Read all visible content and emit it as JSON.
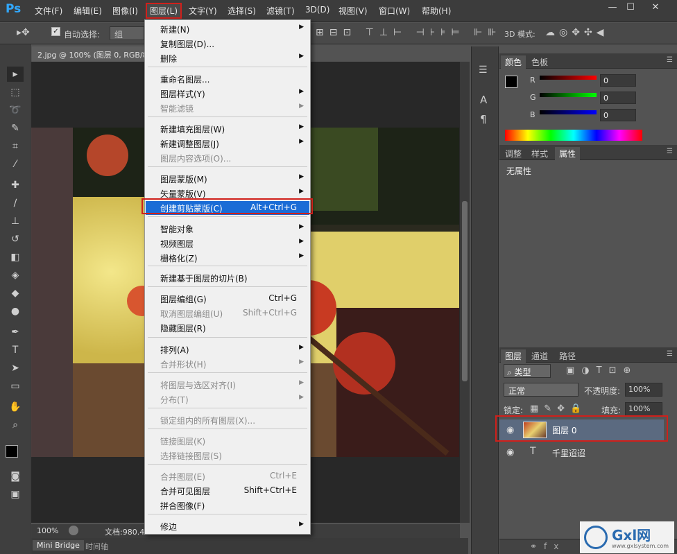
{
  "app": {
    "logo": "Ps"
  },
  "menubar": {
    "items": [
      "文件(F)",
      "编辑(E)",
      "图像(I)",
      "图层(L)",
      "文字(Y)",
      "选择(S)",
      "滤镜(T)",
      "3D(D)",
      "视图(V)",
      "窗口(W)",
      "帮助(H)"
    ],
    "window_buttons": [
      "—",
      "☐",
      "✕"
    ]
  },
  "optionsbar": {
    "auto_select_label": "自动选择:",
    "auto_select_value": "组",
    "mode3d_label": "3D 模式:"
  },
  "document": {
    "tab_title": "2.jpg @ 100% (图层 0, RGB/8)",
    "zoom": "100%",
    "doc_info": "文档:980.4"
  },
  "bottom_tabs": [
    "Mini Bridge",
    "时间轴"
  ],
  "layer_menu": {
    "items": [
      {
        "label": "新建(N)",
        "shortcut": "",
        "arrow": true,
        "disabled": false
      },
      {
        "label": "复制图层(D)...",
        "shortcut": "",
        "arrow": false,
        "disabled": false
      },
      {
        "label": "删除",
        "shortcut": "",
        "arrow": true,
        "disabled": false
      },
      {
        "label": "重命名图层...",
        "shortcut": "",
        "arrow": false,
        "disabled": false
      },
      {
        "label": "图层样式(Y)",
        "shortcut": "",
        "arrow": true,
        "disabled": false
      },
      {
        "label": "智能滤镜",
        "shortcut": "",
        "arrow": true,
        "disabled": true
      },
      {
        "label": "新建填充图层(W)",
        "shortcut": "",
        "arrow": true,
        "disabled": false
      },
      {
        "label": "新建调整图层(J)",
        "shortcut": "",
        "arrow": true,
        "disabled": false
      },
      {
        "label": "图层内容选项(O)...",
        "shortcut": "",
        "arrow": false,
        "disabled": true
      },
      {
        "label": "图层蒙版(M)",
        "shortcut": "",
        "arrow": true,
        "disabled": false
      },
      {
        "label": "矢量蒙版(V)",
        "shortcut": "",
        "arrow": true,
        "disabled": false
      },
      {
        "label": "创建剪贴蒙版(C)",
        "shortcut": "Alt+Ctrl+G",
        "arrow": false,
        "disabled": false,
        "selected": true
      },
      {
        "label": "智能对象",
        "shortcut": "",
        "arrow": true,
        "disabled": false
      },
      {
        "label": "视频图层",
        "shortcut": "",
        "arrow": true,
        "disabled": false
      },
      {
        "label": "栅格化(Z)",
        "shortcut": "",
        "arrow": true,
        "disabled": false
      },
      {
        "label": "新建基于图层的切片(B)",
        "shortcut": "",
        "arrow": false,
        "disabled": false
      },
      {
        "label": "图层编组(G)",
        "shortcut": "Ctrl+G",
        "arrow": false,
        "disabled": false
      },
      {
        "label": "取消图层编组(U)",
        "shortcut": "Shift+Ctrl+G",
        "arrow": false,
        "disabled": true
      },
      {
        "label": "隐藏图层(R)",
        "shortcut": "",
        "arrow": false,
        "disabled": false
      },
      {
        "label": "排列(A)",
        "shortcut": "",
        "arrow": true,
        "disabled": false
      },
      {
        "label": "合并形状(H)",
        "shortcut": "",
        "arrow": true,
        "disabled": true
      },
      {
        "label": "将图层与选区对齐(I)",
        "shortcut": "",
        "arrow": true,
        "disabled": true
      },
      {
        "label": "分布(T)",
        "shortcut": "",
        "arrow": true,
        "disabled": true
      },
      {
        "label": "锁定组内的所有图层(X)...",
        "shortcut": "",
        "arrow": false,
        "disabled": true
      },
      {
        "label": "链接图层(K)",
        "shortcut": "",
        "arrow": false,
        "disabled": true
      },
      {
        "label": "选择链接图层(S)",
        "shortcut": "",
        "arrow": false,
        "disabled": true
      },
      {
        "label": "合并图层(E)",
        "shortcut": "Ctrl+E",
        "arrow": false,
        "disabled": true
      },
      {
        "label": "合并可见图层",
        "shortcut": "Shift+Ctrl+E",
        "arrow": false,
        "disabled": false
      },
      {
        "label": "拼合图像(F)",
        "shortcut": "",
        "arrow": false,
        "disabled": false
      },
      {
        "label": "修边",
        "shortcut": "",
        "arrow": true,
        "disabled": false
      }
    ]
  },
  "color_panel": {
    "tabs": [
      "颜色",
      "色板"
    ],
    "channels": [
      {
        "label": "R",
        "value": "0"
      },
      {
        "label": "G",
        "value": "0"
      },
      {
        "label": "B",
        "value": "0"
      }
    ]
  },
  "properties_panel": {
    "tabs": [
      "调整",
      "样式",
      "属性"
    ],
    "empty_text": "无属性"
  },
  "layers_panel": {
    "tabs": [
      "图层",
      "通道",
      "路径"
    ],
    "filter_label": "类型",
    "blend_mode": "正常",
    "opacity_label": "不透明度:",
    "opacity_value": "100%",
    "lock_label": "锁定:",
    "fill_label": "填充:",
    "fill_value": "100%",
    "layers": [
      {
        "name": "图层 0",
        "selected": true
      },
      {
        "name": "千里迢迢",
        "selected": false
      }
    ]
  },
  "watermark": {
    "text": "Gxl网",
    "sub": "www.gxlsystem.com"
  }
}
